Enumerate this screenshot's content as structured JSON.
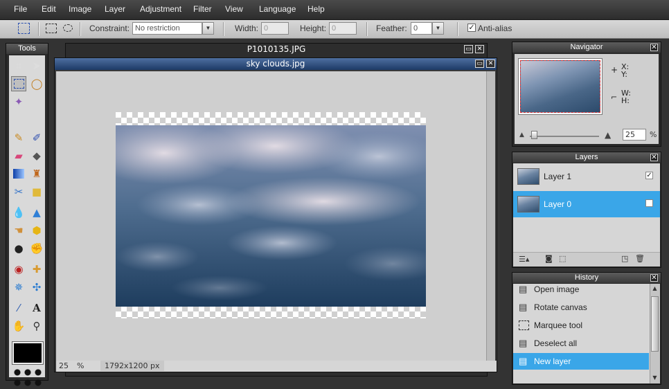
{
  "menu": [
    "File",
    "Edit",
    "Image",
    "Layer",
    "Adjustment",
    "Filter",
    "View",
    "Language",
    "Help"
  ],
  "options": {
    "constraint_label": "Constraint:",
    "constraint_value": "No restriction",
    "width_label": "Width:",
    "width_value": "0",
    "height_label": "Height:",
    "height_value": "0",
    "feather_label": "Feather:",
    "feather_value": "0",
    "antialias_label": "Anti-alias",
    "antialias_checked": true
  },
  "tools": {
    "title": "Tools",
    "icons": [
      "crop-icon",
      "move-icon",
      "marquee-icon",
      "lasso-icon",
      "magic-wand-icon",
      "pencil-icon",
      "brush-icon",
      "eraser-icon",
      "paint-bucket-icon",
      "gradient-icon",
      "clone-stamp-icon",
      "color-replace-icon",
      "drawing-icon",
      "blur-icon",
      "sharpen-icon",
      "smudge-icon",
      "sponge-icon",
      "dodge-icon",
      "burn-icon",
      "red-eye-icon",
      "spot-heal-icon",
      "bloat-icon",
      "pinch-icon",
      "color-picker-icon",
      "type-icon",
      "hand-icon",
      "zoom-icon"
    ]
  },
  "windows": {
    "back_title": "P1010135.JPG",
    "front_title": "sky clouds.jpg",
    "zoom_value": "25",
    "zoom_unit": "%",
    "dimensions": "1792x1200 px"
  },
  "navigator": {
    "title": "Navigator",
    "x_label": "X:",
    "y_label": "Y:",
    "w_label": "W:",
    "h_label": "H:",
    "zoom_value": "25",
    "zoom_unit": "%"
  },
  "layers": {
    "title": "Layers",
    "items": [
      {
        "name": "Layer 1",
        "visible": true,
        "selected": false
      },
      {
        "name": "Layer 0",
        "visible": false,
        "selected": true
      }
    ]
  },
  "history": {
    "title": "History",
    "items": [
      {
        "label": "Open image",
        "icon": "document-icon"
      },
      {
        "label": "Rotate canvas",
        "icon": "document-icon"
      },
      {
        "label": "Marquee tool",
        "icon": "marquee-icon"
      },
      {
        "label": "Deselect all",
        "icon": "document-icon"
      },
      {
        "label": "New layer",
        "icon": "document-icon"
      }
    ]
  },
  "colors": {
    "accent": "#3aa6e8",
    "panel_bg": "#2a2a2a",
    "canvas_bg": "#cfcfcf",
    "foreground_swatch": "#000000"
  }
}
